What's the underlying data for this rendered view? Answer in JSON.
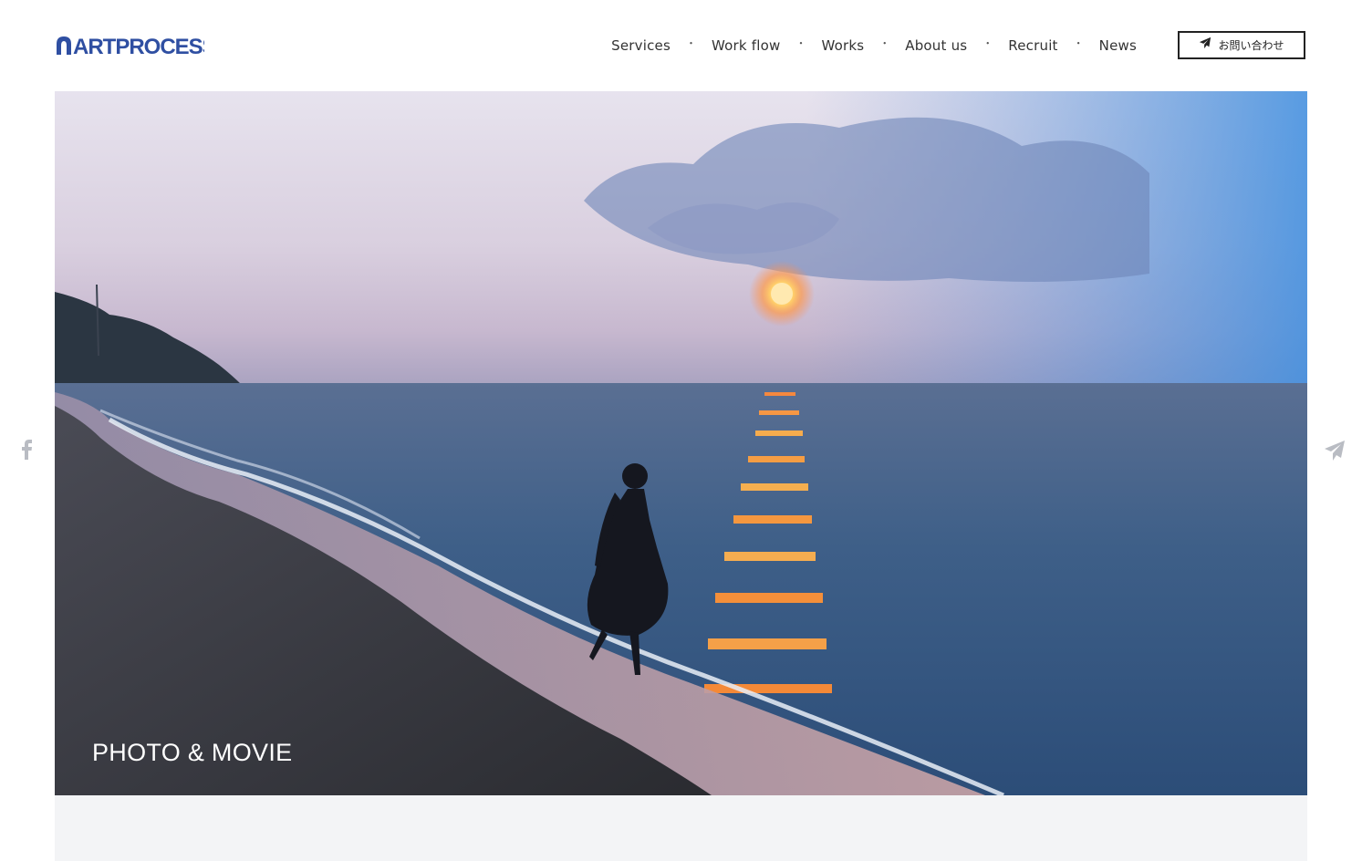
{
  "brand": {
    "name": "ARTPROCESS",
    "color": "#2f4fa2"
  },
  "nav": {
    "items": [
      {
        "label": "Services"
      },
      {
        "label": "Work flow"
      },
      {
        "label": "Works"
      },
      {
        "label": "About us"
      },
      {
        "label": "Recruit"
      },
      {
        "label": "News"
      }
    ],
    "separator": "・"
  },
  "contact_button": {
    "label": "お問い合わせ",
    "icon": "paper-plane-icon"
  },
  "hero": {
    "caption": "PHOTO & MOVIE"
  },
  "side": {
    "left_icon": "facebook-icon",
    "right_icon": "paper-plane-icon"
  }
}
